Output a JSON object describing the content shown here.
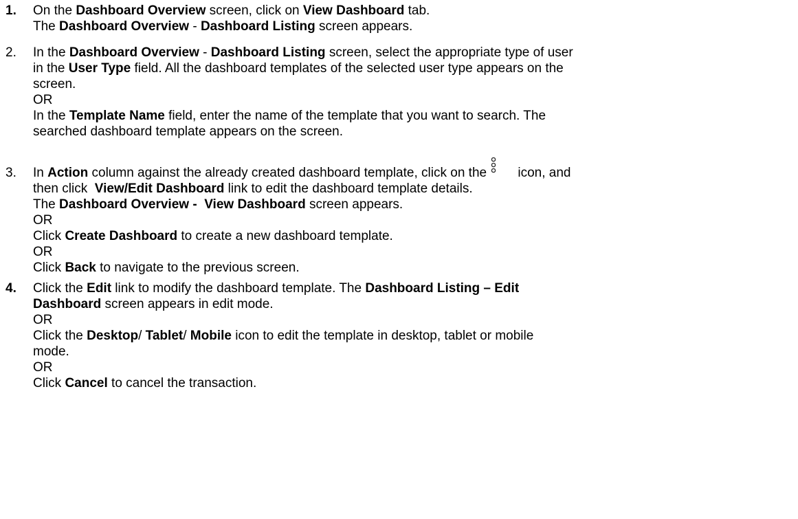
{
  "steps": [
    {
      "number": "1.",
      "lines": [
        [
          "On the ",
          "Dashboard Overview",
          " screen, click on ",
          "View Dashboard",
          " tab."
        ],
        [
          "The ",
          "Dashboard Overview",
          " - ",
          "Dashboard Listing",
          " screen appears."
        ]
      ]
    },
    {
      "number": "2.",
      "lines": [
        [
          "In the ",
          "Dashboard Overview",
          " - ",
          "Dashboard Listing",
          " screen, select the appropriate type of user"
        ],
        [
          "in the ",
          "User Type",
          " field. All the dashboard templates of the selected user type appears on the"
        ],
        [
          "screen."
        ],
        [
          "OR"
        ],
        [
          "In the ",
          "Template Name",
          " field, enter the name of the template that you want to search. The"
        ],
        [
          "searched dashboard template appears on the screen."
        ]
      ]
    },
    {
      "number": "3.",
      "icon_name": "kebab-menu-icon",
      "lines": [
        [
          "In ",
          "Action",
          " column against the already created dashboard template, click on the ",
          "icon, and"
        ],
        [
          "then click  ",
          "View/Edit Dashboard",
          " link to edit the dashboard template details."
        ],
        [
          "The ",
          "Dashboard Overview -  View Dashboard",
          " screen appears."
        ],
        [
          "OR"
        ],
        [
          "Click ",
          "Create Dashboard",
          " to create a new dashboard template."
        ],
        [
          "OR"
        ],
        [
          "Click ",
          "Back",
          " to navigate to the previous screen."
        ]
      ]
    },
    {
      "number": "4.",
      "lines": [
        [
          "Click the ",
          "Edit",
          " link to modify the dashboard template. The ",
          "Dashboard Listing – Edit"
        ],
        [
          "Dashboard",
          " screen appears in edit mode."
        ],
        [
          "OR"
        ],
        [
          "Click the ",
          "Desktop",
          "/ ",
          "Tablet",
          "/ ",
          "Mobile",
          " icon to edit the template in desktop, tablet or mobile"
        ],
        [
          "mode."
        ],
        [
          "OR"
        ],
        [
          "Click ",
          "Cancel",
          " to cancel the transaction."
        ]
      ]
    }
  ]
}
